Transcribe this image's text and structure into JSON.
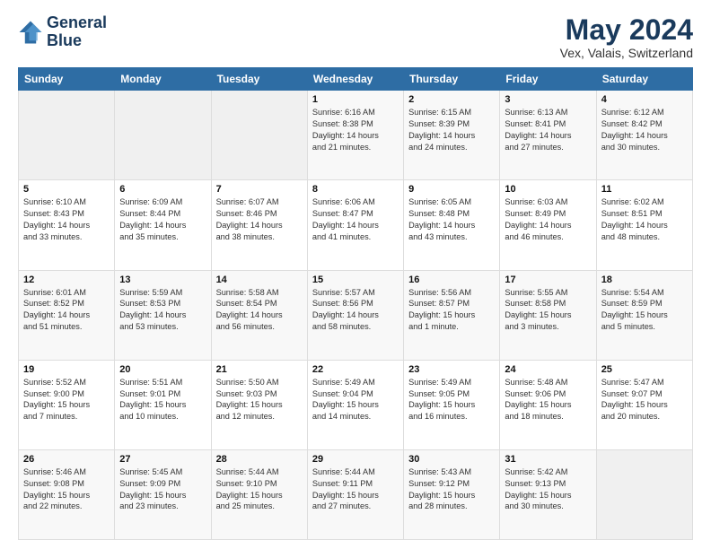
{
  "header": {
    "logo_line1": "General",
    "logo_line2": "Blue",
    "title": "May 2024",
    "subtitle": "Vex, Valais, Switzerland"
  },
  "weekdays": [
    "Sunday",
    "Monday",
    "Tuesday",
    "Wednesday",
    "Thursday",
    "Friday",
    "Saturday"
  ],
  "weeks": [
    [
      {
        "day": "",
        "detail": ""
      },
      {
        "day": "",
        "detail": ""
      },
      {
        "day": "",
        "detail": ""
      },
      {
        "day": "1",
        "detail": "Sunrise: 6:16 AM\nSunset: 8:38 PM\nDaylight: 14 hours\nand 21 minutes."
      },
      {
        "day": "2",
        "detail": "Sunrise: 6:15 AM\nSunset: 8:39 PM\nDaylight: 14 hours\nand 24 minutes."
      },
      {
        "day": "3",
        "detail": "Sunrise: 6:13 AM\nSunset: 8:41 PM\nDaylight: 14 hours\nand 27 minutes."
      },
      {
        "day": "4",
        "detail": "Sunrise: 6:12 AM\nSunset: 8:42 PM\nDaylight: 14 hours\nand 30 minutes."
      }
    ],
    [
      {
        "day": "5",
        "detail": "Sunrise: 6:10 AM\nSunset: 8:43 PM\nDaylight: 14 hours\nand 33 minutes."
      },
      {
        "day": "6",
        "detail": "Sunrise: 6:09 AM\nSunset: 8:44 PM\nDaylight: 14 hours\nand 35 minutes."
      },
      {
        "day": "7",
        "detail": "Sunrise: 6:07 AM\nSunset: 8:46 PM\nDaylight: 14 hours\nand 38 minutes."
      },
      {
        "day": "8",
        "detail": "Sunrise: 6:06 AM\nSunset: 8:47 PM\nDaylight: 14 hours\nand 41 minutes."
      },
      {
        "day": "9",
        "detail": "Sunrise: 6:05 AM\nSunset: 8:48 PM\nDaylight: 14 hours\nand 43 minutes."
      },
      {
        "day": "10",
        "detail": "Sunrise: 6:03 AM\nSunset: 8:49 PM\nDaylight: 14 hours\nand 46 minutes."
      },
      {
        "day": "11",
        "detail": "Sunrise: 6:02 AM\nSunset: 8:51 PM\nDaylight: 14 hours\nand 48 minutes."
      }
    ],
    [
      {
        "day": "12",
        "detail": "Sunrise: 6:01 AM\nSunset: 8:52 PM\nDaylight: 14 hours\nand 51 minutes."
      },
      {
        "day": "13",
        "detail": "Sunrise: 5:59 AM\nSunset: 8:53 PM\nDaylight: 14 hours\nand 53 minutes."
      },
      {
        "day": "14",
        "detail": "Sunrise: 5:58 AM\nSunset: 8:54 PM\nDaylight: 14 hours\nand 56 minutes."
      },
      {
        "day": "15",
        "detail": "Sunrise: 5:57 AM\nSunset: 8:56 PM\nDaylight: 14 hours\nand 58 minutes."
      },
      {
        "day": "16",
        "detail": "Sunrise: 5:56 AM\nSunset: 8:57 PM\nDaylight: 15 hours\nand 1 minute."
      },
      {
        "day": "17",
        "detail": "Sunrise: 5:55 AM\nSunset: 8:58 PM\nDaylight: 15 hours\nand 3 minutes."
      },
      {
        "day": "18",
        "detail": "Sunrise: 5:54 AM\nSunset: 8:59 PM\nDaylight: 15 hours\nand 5 minutes."
      }
    ],
    [
      {
        "day": "19",
        "detail": "Sunrise: 5:52 AM\nSunset: 9:00 PM\nDaylight: 15 hours\nand 7 minutes."
      },
      {
        "day": "20",
        "detail": "Sunrise: 5:51 AM\nSunset: 9:01 PM\nDaylight: 15 hours\nand 10 minutes."
      },
      {
        "day": "21",
        "detail": "Sunrise: 5:50 AM\nSunset: 9:03 PM\nDaylight: 15 hours\nand 12 minutes."
      },
      {
        "day": "22",
        "detail": "Sunrise: 5:49 AM\nSunset: 9:04 PM\nDaylight: 15 hours\nand 14 minutes."
      },
      {
        "day": "23",
        "detail": "Sunrise: 5:49 AM\nSunset: 9:05 PM\nDaylight: 15 hours\nand 16 minutes."
      },
      {
        "day": "24",
        "detail": "Sunrise: 5:48 AM\nSunset: 9:06 PM\nDaylight: 15 hours\nand 18 minutes."
      },
      {
        "day": "25",
        "detail": "Sunrise: 5:47 AM\nSunset: 9:07 PM\nDaylight: 15 hours\nand 20 minutes."
      }
    ],
    [
      {
        "day": "26",
        "detail": "Sunrise: 5:46 AM\nSunset: 9:08 PM\nDaylight: 15 hours\nand 22 minutes."
      },
      {
        "day": "27",
        "detail": "Sunrise: 5:45 AM\nSunset: 9:09 PM\nDaylight: 15 hours\nand 23 minutes."
      },
      {
        "day": "28",
        "detail": "Sunrise: 5:44 AM\nSunset: 9:10 PM\nDaylight: 15 hours\nand 25 minutes."
      },
      {
        "day": "29",
        "detail": "Sunrise: 5:44 AM\nSunset: 9:11 PM\nDaylight: 15 hours\nand 27 minutes."
      },
      {
        "day": "30",
        "detail": "Sunrise: 5:43 AM\nSunset: 9:12 PM\nDaylight: 15 hours\nand 28 minutes."
      },
      {
        "day": "31",
        "detail": "Sunrise: 5:42 AM\nSunset: 9:13 PM\nDaylight: 15 hours\nand 30 minutes."
      },
      {
        "day": "",
        "detail": ""
      }
    ]
  ]
}
